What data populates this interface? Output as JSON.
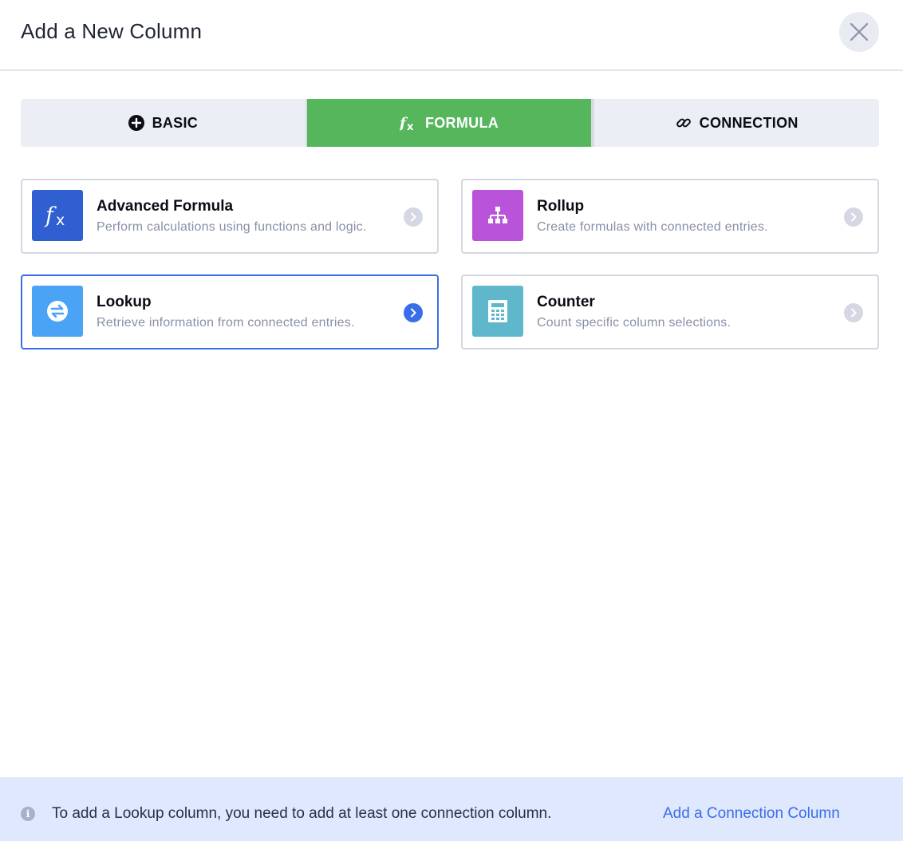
{
  "modal": {
    "title": "Add a New Column"
  },
  "tabs": [
    {
      "label": "BASIC",
      "icon": "plus-circle-icon",
      "active": false
    },
    {
      "label": "FORMULA",
      "icon": "fx-icon",
      "active": true
    },
    {
      "label": "CONNECTION",
      "icon": "link-icon",
      "active": false
    }
  ],
  "cards": [
    {
      "title": "Advanced Formula",
      "desc": "Perform calculations using functions and logic.",
      "icon": "fx-icon",
      "color": "#2f5fd0",
      "selected": false
    },
    {
      "title": "Rollup",
      "desc": "Create formulas with connected entries.",
      "icon": "hierarchy-icon",
      "color": "#b953d9",
      "selected": false
    },
    {
      "title": "Lookup",
      "desc": "Retrieve information from connected entries.",
      "icon": "swap-arrows-icon",
      "color": "#4aa3f5",
      "selected": true
    },
    {
      "title": "Counter",
      "desc": "Count specific column selections.",
      "icon": "calculator-icon",
      "color": "#5fb7cc",
      "selected": false
    }
  ],
  "footer": {
    "message": "To add a Lookup column, you need to add at least one connection column.",
    "link": "Add a Connection Column"
  },
  "colors": {
    "active_tab": "#55b65b",
    "accent": "#3a6ee8",
    "footer_bg": "#dfe8fc"
  }
}
